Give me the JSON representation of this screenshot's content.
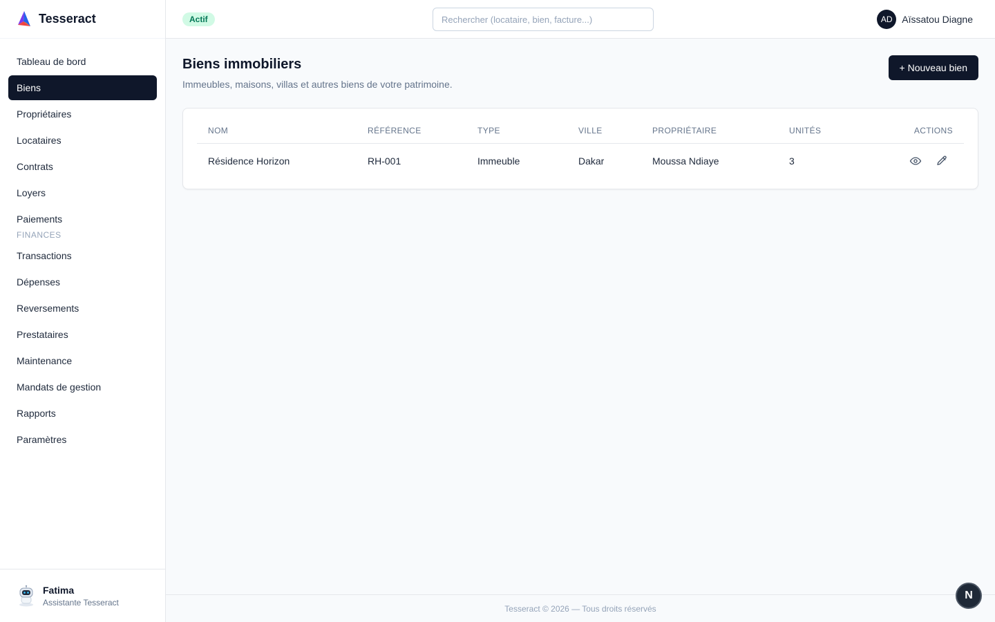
{
  "app": {
    "name": "Tesseract"
  },
  "sidebar": {
    "items": [
      {
        "label": "Tableau de bord"
      },
      {
        "label": "Biens",
        "active": true
      },
      {
        "label": "Propriétaires"
      },
      {
        "label": "Locataires"
      },
      {
        "label": "Contrats"
      },
      {
        "label": "Loyers"
      },
      {
        "label": "Paiements"
      }
    ],
    "section_finances": "FINANCES",
    "finance_items": [
      {
        "label": "Transactions"
      },
      {
        "label": "Dépenses"
      },
      {
        "label": "Reversements"
      },
      {
        "label": "Prestataires"
      },
      {
        "label": "Maintenance"
      },
      {
        "label": "Mandats de gestion"
      },
      {
        "label": "Rapports"
      },
      {
        "label": "Paramètres"
      }
    ],
    "assistant": {
      "name": "Fatima",
      "role": "Assistante Tesseract"
    }
  },
  "header": {
    "status_badge": "Actif",
    "search_placeholder": "Rechercher (locataire, bien, facture...)",
    "user": {
      "initials": "AD",
      "name": "Aïssatou Diagne"
    }
  },
  "page": {
    "title": "Biens immobiliers",
    "subtitle": "Immeubles, maisons, villas et autres biens de votre patrimoine.",
    "new_button": "+ Nouveau bien"
  },
  "table": {
    "columns": [
      "NOM",
      "RÉFÉRENCE",
      "TYPE",
      "VILLE",
      "PROPRIÉTAIRE",
      "UNITÉS",
      "ACTIONS"
    ],
    "rows": [
      {
        "nom": "Résidence Horizon",
        "reference": "RH-001",
        "type": "Immeuble",
        "ville": "Dakar",
        "proprietaire": "Moussa Ndiaye",
        "unites": "3"
      }
    ]
  },
  "footer": {
    "text": "Tesseract © 2026 — Tous droits réservés"
  },
  "fab": {
    "label": "N"
  },
  "colors": {
    "primary": "#0f172a",
    "badge_bg": "#d1fae5",
    "badge_text": "#047857",
    "muted": "#64748b"
  },
  "icons": {
    "brand": "tesseract-logo",
    "view": "eye-icon",
    "edit": "pencil-icon",
    "assistant": "robot-icon"
  }
}
